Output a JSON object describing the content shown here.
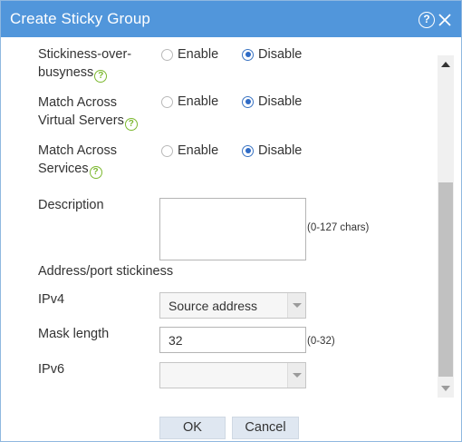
{
  "dialog": {
    "title": "Create Sticky Group",
    "help_glyph": "?"
  },
  "form": {
    "stickiness_over_busyness": {
      "label_line1": "Stickiness-over-",
      "label_line2": "busyness",
      "enable_label": "Enable",
      "disable_label": "Disable",
      "selected": "Disable"
    },
    "match_across_virtual_servers": {
      "label_line1": "Match Across",
      "label_line2": "Virtual Servers",
      "enable_label": "Enable",
      "disable_label": "Disable",
      "selected": "Disable"
    },
    "match_across_services": {
      "label_line1": "Match Across",
      "label_line2": "Services",
      "enable_label": "Enable",
      "disable_label": "Disable",
      "selected": "Disable"
    },
    "description": {
      "label": "Description",
      "value": "",
      "hint": "(0-127 chars)"
    },
    "address_port_stickiness": {
      "heading": "Address/port stickiness"
    },
    "ipv4": {
      "label": "IPv4",
      "selected": "Source address"
    },
    "mask_length": {
      "label": "Mask length",
      "value": "32",
      "hint": "(0-32)"
    },
    "ipv6": {
      "label": "IPv6",
      "selected": ""
    }
  },
  "footer": {
    "ok_label": "OK",
    "cancel_label": "Cancel"
  },
  "colors": {
    "titlebar": "#5196db",
    "help_icon": "#7cb82f",
    "radio_selected": "#2e6bc6",
    "button_bg": "#dfe7f1"
  },
  "icons": {
    "help": "help-icon",
    "close": "close-icon",
    "field_help": "question-mark-icon",
    "dropdown": "chevron-down-icon"
  }
}
